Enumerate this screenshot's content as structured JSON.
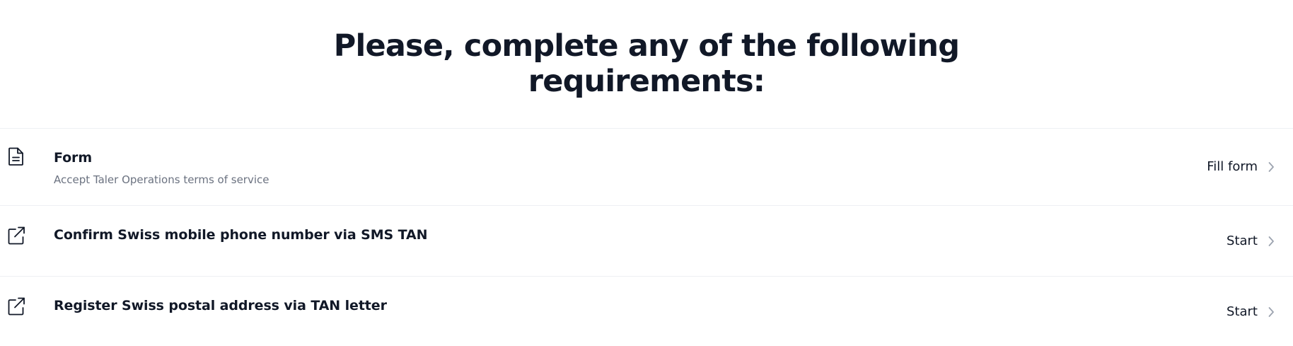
{
  "heading": {
    "line1": "Please, complete any of the following",
    "line2": "requirements:"
  },
  "requirements": [
    {
      "icon": "document-icon",
      "title": "Form",
      "subtitle": "Accept Taler Operations terms of service",
      "action_label": "Fill form"
    },
    {
      "icon": "external-link-icon",
      "title": "Confirm Swiss mobile phone number via SMS TAN",
      "action_label": "Start"
    },
    {
      "icon": "external-link-icon",
      "title": "Register Swiss postal address via TAN letter",
      "action_label": "Start"
    }
  ],
  "colors": {
    "text": "#111827",
    "muted": "#6b7280",
    "divider": "#eef0f3",
    "chevron": "#9ca3af"
  }
}
